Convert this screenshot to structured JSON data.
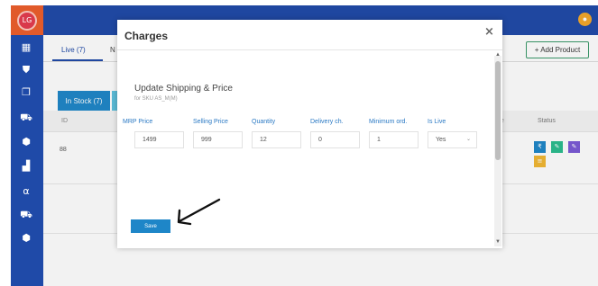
{
  "brand": {
    "logo_text": "LG"
  },
  "background": {
    "tabs": [
      {
        "label": "Live (7)"
      },
      {
        "label": "N"
      }
    ],
    "add_product_label": "+ Add Product",
    "stock_tab_label": "In Stock (7)",
    "table": {
      "headers": {
        "id": "ID",
        "partial": "e",
        "status": "Status"
      },
      "rows": [
        {
          "id": "88"
        }
      ]
    }
  },
  "modal": {
    "title": "Charges",
    "close_label": "×",
    "section_title": "Update Shipping & Price",
    "section_subtitle": "for SKU AS_M(M)",
    "fields": [
      {
        "label": "MRP Price",
        "value": "1499"
      },
      {
        "label": "Selling Price",
        "value": "999"
      },
      {
        "label": "Quantity",
        "value": "12"
      },
      {
        "label": "Delivery ch.",
        "value": "0"
      },
      {
        "label": "Minimum ord.",
        "value": "1"
      },
      {
        "label": "Is Live",
        "value": "Yes"
      }
    ],
    "save_label": "Save"
  },
  "colors": {
    "sidebar": "#1f4aa8",
    "logo_bg": "#e15a2a",
    "accent_blue": "#1e86c8",
    "label_blue": "#2a79c4",
    "status_blue": "#1e86c8",
    "status_green": "#2bbd8e",
    "status_purple": "#7b5ad6",
    "status_yellow": "#f2b732"
  }
}
